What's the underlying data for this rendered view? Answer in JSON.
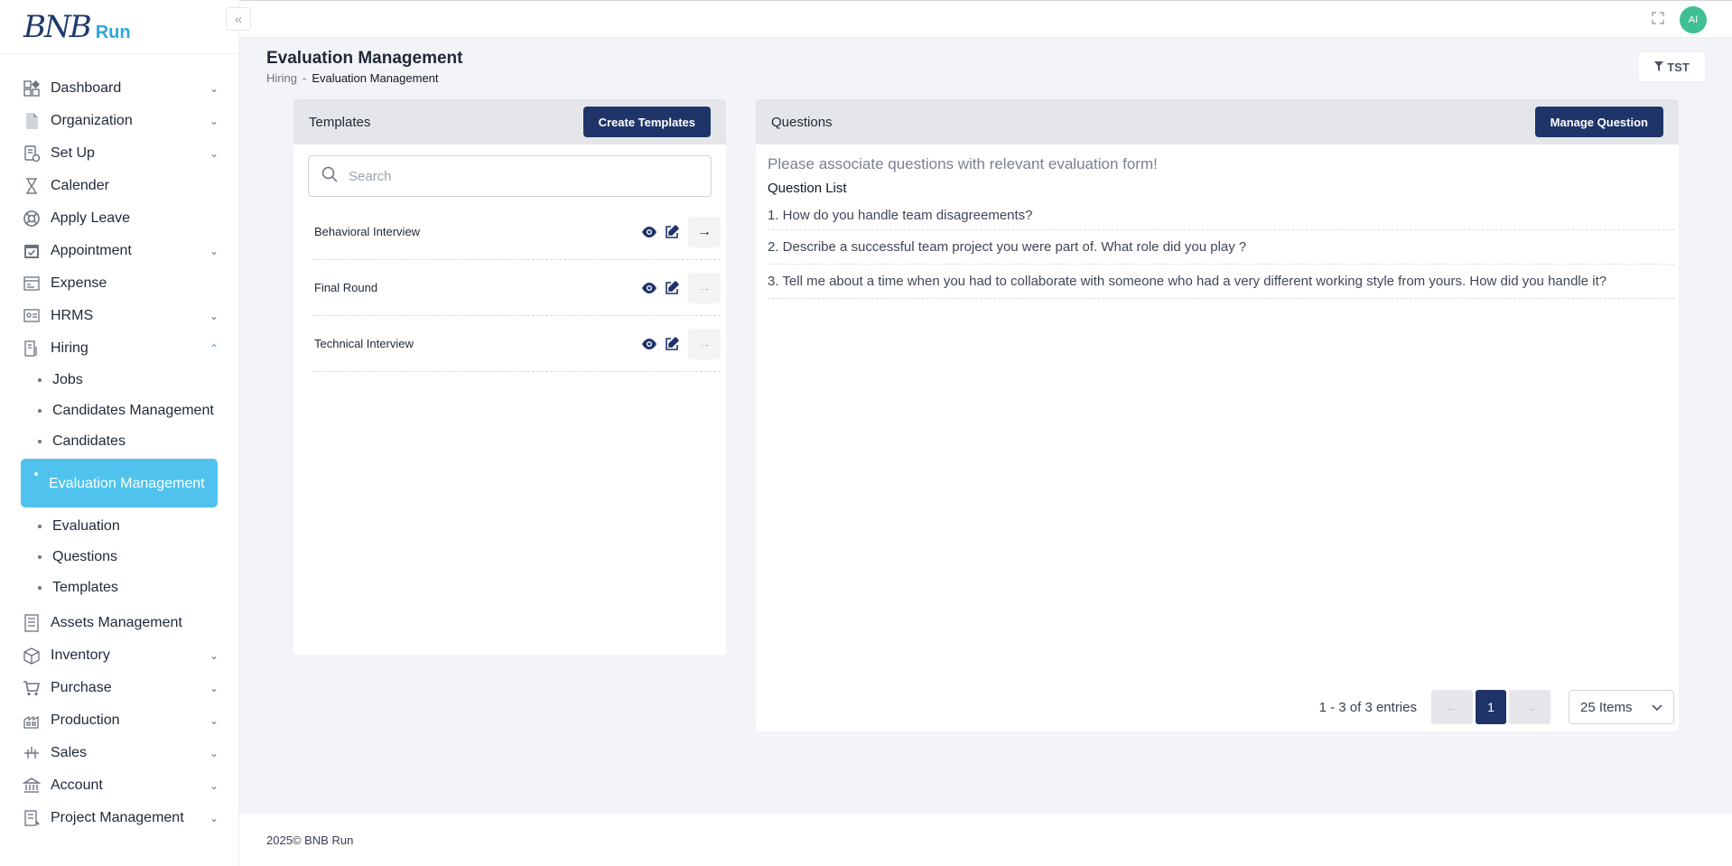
{
  "brand": {
    "logo_text": "BNB",
    "logo_suffix": "Run"
  },
  "sidebar": {
    "items": [
      {
        "label": "Dashboard",
        "icon": "dashboard-icon",
        "chevron": "down"
      },
      {
        "label": "Organization",
        "icon": "document-icon",
        "chevron": "down"
      },
      {
        "label": "Set Up",
        "icon": "setup-icon",
        "chevron": "down"
      },
      {
        "label": "Calender",
        "icon": "hourglass-icon",
        "chevron": ""
      },
      {
        "label": "Apply Leave",
        "icon": "lifebuoy-icon",
        "chevron": ""
      },
      {
        "label": "Appointment",
        "icon": "calendar-check-icon",
        "chevron": "down"
      },
      {
        "label": "Expense",
        "icon": "expense-icon",
        "chevron": ""
      },
      {
        "label": "HRMS",
        "icon": "hrms-icon",
        "chevron": "down"
      },
      {
        "label": "Hiring",
        "icon": "hiring-icon",
        "chevron": "up"
      }
    ],
    "hiring_sub": [
      {
        "label": "Jobs"
      },
      {
        "label": "Candidates Management"
      },
      {
        "label": "Candidates"
      },
      {
        "label": "Evaluation Management",
        "active": true
      },
      {
        "label": "Evaluation"
      },
      {
        "label": "Questions"
      },
      {
        "label": "Templates"
      }
    ],
    "items_after": [
      {
        "label": "Assets Management",
        "icon": "assets-icon",
        "chevron": ""
      },
      {
        "label": "Inventory",
        "icon": "inventory-icon",
        "chevron": "down"
      },
      {
        "label": "Purchase",
        "icon": "cart-icon",
        "chevron": "down"
      },
      {
        "label": "Production",
        "icon": "factory-icon",
        "chevron": "down"
      },
      {
        "label": "Sales",
        "icon": "sales-icon",
        "chevron": "down"
      },
      {
        "label": "Account",
        "icon": "bank-icon",
        "chevron": "down"
      },
      {
        "label": "Project Management",
        "icon": "project-icon",
        "chevron": "down"
      }
    ]
  },
  "topbar": {
    "avatar_initials": "AI"
  },
  "header": {
    "title": "Evaluation Management",
    "breadcrumb": {
      "parent": "Hiring",
      "separator": "-",
      "current": "Evaluation Management"
    },
    "filter_label": "TST"
  },
  "templates": {
    "title": "Templates",
    "create_label": "Create Templates",
    "search_placeholder": "Search",
    "rows": [
      {
        "name": "Behavioral Interview",
        "arrow_active": true
      },
      {
        "name": "Final Round",
        "arrow_active": false
      },
      {
        "name": "Technical Interview",
        "arrow_active": false
      }
    ]
  },
  "questions": {
    "title": "Questions",
    "manage_label": "Manage Question",
    "hint": "Please associate questions with relevant evaluation form!",
    "list_title": "Question List",
    "items": [
      "1. How do you handle team disagreements?",
      "2. Describe a successful team project you were part of. What role did you play ?",
      "3. Tell me about a time when you had to collaborate with someone who had a very different working style from yours. How did you handle it?"
    ],
    "pagination": {
      "summary": "1 - 3 of 3 entries",
      "prev": "←",
      "current_page": "1",
      "next": "→",
      "per_page": "25 Items"
    }
  },
  "footer": {
    "text": "2025© BNB Run"
  },
  "colors": {
    "primary": "#1f3468",
    "active_nav": "#4fc3ee",
    "avatar": "#3fbf93"
  }
}
